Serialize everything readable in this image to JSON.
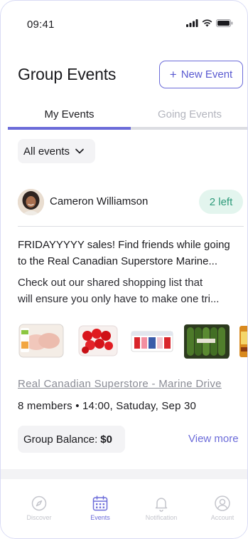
{
  "status_bar": {
    "time": "09:41"
  },
  "header": {
    "title": "Group Events",
    "new_event_label": "New Event"
  },
  "tabs": [
    {
      "label": "My Events",
      "active": true
    },
    {
      "label": "Going Events",
      "active": false
    }
  ],
  "filter": {
    "selected": "All events"
  },
  "event": {
    "host_name": "Cameron Williamson",
    "spots_left": "2 left",
    "title_lines": [
      "FRIDAYYYYY sales! Find friends while going",
      "to the Real Canadian Superstore Marine..."
    ],
    "description_lines": [
      "Check out our shared shopping list that",
      "will ensure you only have to make one tri..."
    ],
    "products": [
      "chicken-breast",
      "cherry-tomatoes",
      "yogurt-pack",
      "zucchini",
      "grocery-item"
    ],
    "store_name": "Real Canadian Superstore - Marine Drive",
    "details": "8 members • 14:00, Satuday, Sep 30",
    "balance_label": "Group Balance:",
    "balance_value": "$0",
    "view_more_label": "View more"
  },
  "bottom_nav": [
    {
      "label": "Discover",
      "icon": "compass-icon",
      "active": false
    },
    {
      "label": "Events",
      "icon": "calendar-icon",
      "active": true
    },
    {
      "label": "Notification",
      "icon": "bell-icon",
      "active": false
    },
    {
      "label": "Account",
      "icon": "user-circle-icon",
      "active": false
    }
  ],
  "colors": {
    "accent": "#6b6bd9",
    "badge_bg": "#e3f5ee",
    "badge_text": "#2d9a7a"
  }
}
